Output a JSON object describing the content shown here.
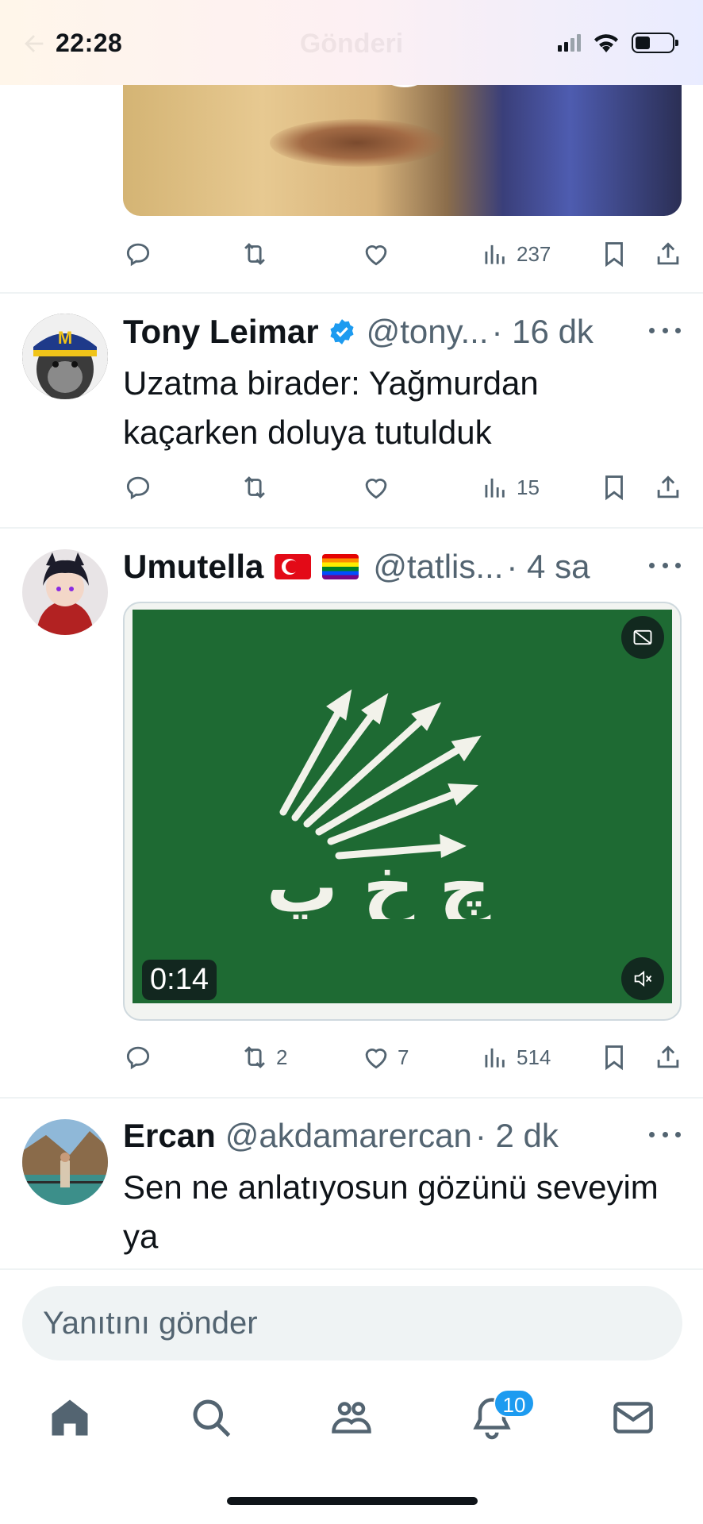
{
  "status_bar": {
    "time": "22:28"
  },
  "header": {
    "title": "Gönderi"
  },
  "top_tweet_actions": {
    "views": "237"
  },
  "tweets": [
    {
      "name": "Tony Leimar",
      "handle": "@tony...",
      "time": "· 16 dk",
      "text": "Uzatma birader: Yağmurdan kaçarken doluya tutulduk",
      "views": "15"
    },
    {
      "name": "Umutella",
      "handle": "@tatlis...",
      "time": "· 4 sa",
      "video_duration": "0:14",
      "video_caption_text": "چ خ پ",
      "retweets": "2",
      "likes": "7",
      "views": "514"
    },
    {
      "name": "Ercan",
      "handle": "@akdamarercan",
      "time": "· 2 dk",
      "text": "Sen ne anlatıyosun gözünü seveyim ya"
    }
  ],
  "composer": {
    "placeholder": "Yanıtını gönder"
  },
  "bottom_nav": {
    "notifications_count": "10"
  },
  "colors": {
    "accent": "#1d9bf0",
    "muted": "#536471",
    "text": "#0f1419",
    "video_green": "#1e6a33"
  }
}
